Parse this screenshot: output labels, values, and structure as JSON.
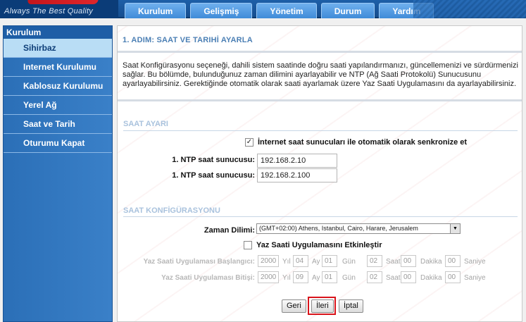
{
  "header": {
    "tagline": "Always The Best Quality",
    "tabs": [
      "Kurulum",
      "Gelişmiş",
      "Yönetim",
      "Durum",
      "Yardım"
    ]
  },
  "sidebar": {
    "heading": "Kurulum",
    "items": [
      {
        "label": "Sihirbaz",
        "active": true
      },
      {
        "label": "Internet Kurulumu",
        "active": false
      },
      {
        "label": "Kablosuz Kurulumu",
        "active": false
      },
      {
        "label": "Yerel Ağ",
        "active": false
      },
      {
        "label": "Saat ve Tarih",
        "active": false
      },
      {
        "label": "Oturumu Kapat",
        "active": false
      }
    ]
  },
  "main": {
    "step_title": "1. ADIM: SAAT VE TARIHİ AYARLA",
    "description": "Saat Konfigürasyonu seçeneği, dahili sistem saatinde doğru saati yapılandırmanızı, güncellemenizi ve sürdürmenizi sağlar. Bu bölümde, bulunduğunuz zaman dilimini ayarlayabilir ve NTP (Ağ Saati Protokolü) Sunucusunu ayarlayabilirsiniz. Gerektiğinde otomatik olarak saati ayarlamak üzere Yaz Saati Uygulamasını da ayarlayabilirsiniz.",
    "time_settings": {
      "section_title": "SAAT AYARI",
      "auto_sync_label": "İnternet saat sunucuları ile otomatik olarak senkronize et",
      "auto_sync_checked": true,
      "ntp1_label": "1. NTP saat sunucusu:",
      "ntp1_value": "192.168.2.10",
      "ntp2_label": "1. NTP saat sunucusu:",
      "ntp2_value": "192.168.2.100"
    },
    "time_config": {
      "section_title": "SAAT KONFİGÜRASYONU",
      "timezone_label": "Zaman Dilimi:",
      "timezone_value": "(GMT+02:00) Athens, Istanbul, Cairo, Harare, Jerusalem",
      "dst_label": "Yaz Saati Uygulamasını Etkinleştir",
      "dst_checked": false,
      "dst_start_label": "Yaz Saati Uygulaması Başlangıcı:",
      "dst_end_label": "Yaz Saati Uygulaması Bitişi:",
      "units": {
        "year": "Yıl",
        "month": "Ay",
        "day": "Gün",
        "hour": "Saat",
        "minute": "Dakika",
        "second": "Saniye"
      },
      "dst_start": {
        "year": "2000",
        "month": "04",
        "day": "01",
        "hour": "02",
        "minute": "00",
        "second": "00"
      },
      "dst_end": {
        "year": "2000",
        "month": "09",
        "day": "01",
        "hour": "02",
        "minute": "00",
        "second": "00"
      }
    },
    "buttons": {
      "back": "Geri",
      "next": "İleri",
      "cancel": "İptal"
    }
  }
}
